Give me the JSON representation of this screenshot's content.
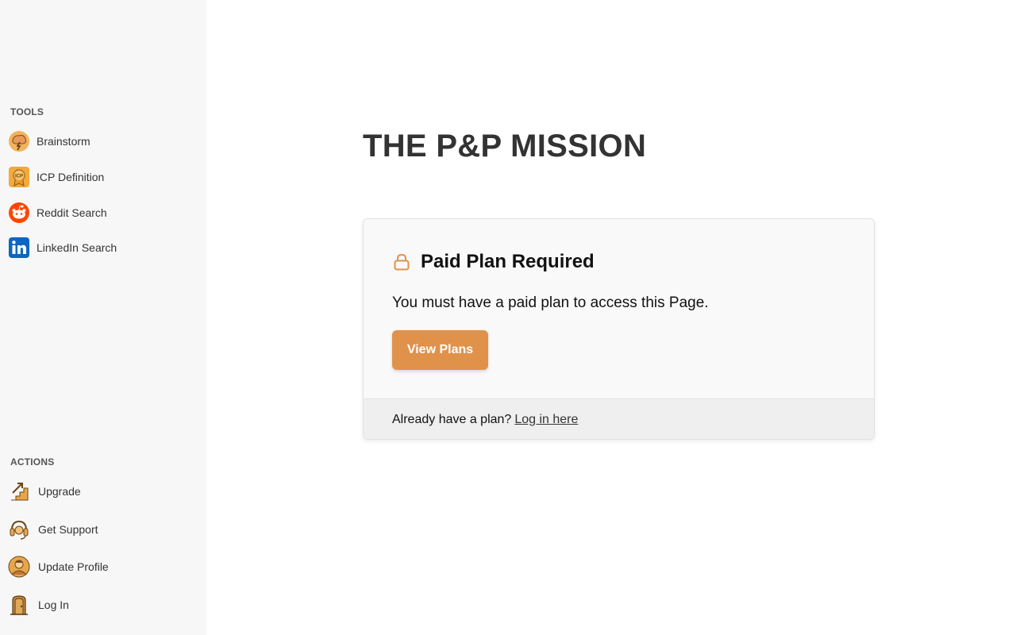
{
  "sidebar": {
    "tools_label": "TOOLS",
    "tools": [
      {
        "label": "Brainstorm",
        "icon": "brainstorm-icon"
      },
      {
        "label": "ICP Definition",
        "icon": "icp-badge-icon"
      },
      {
        "label": "Reddit Search",
        "icon": "reddit-icon"
      },
      {
        "label": "LinkedIn Search",
        "icon": "linkedin-icon"
      }
    ],
    "actions_label": "ACTIONS",
    "actions": [
      {
        "label": "Upgrade",
        "icon": "stairs-upgrade-icon"
      },
      {
        "label": "Get Support",
        "icon": "headset-icon"
      },
      {
        "label": "Update Profile",
        "icon": "profile-avatar-icon"
      },
      {
        "label": "Log In",
        "icon": "door-icon"
      }
    ]
  },
  "main": {
    "title": "THE P&P MISSION",
    "card": {
      "title": "Paid Plan Required",
      "icon": "lock-icon",
      "message": "You must have a paid plan to access this Page.",
      "button_label": "View Plans",
      "footer_text": "Already have a plan?",
      "footer_link": "Log in here"
    }
  },
  "colors": {
    "accent": "#e0924a",
    "sidebar_bg": "#f7f7f7",
    "card_bg": "#f9f9f9",
    "footer_bg": "#efefef",
    "linkedin": "#0a66c2",
    "reddit": "#ff4500"
  }
}
